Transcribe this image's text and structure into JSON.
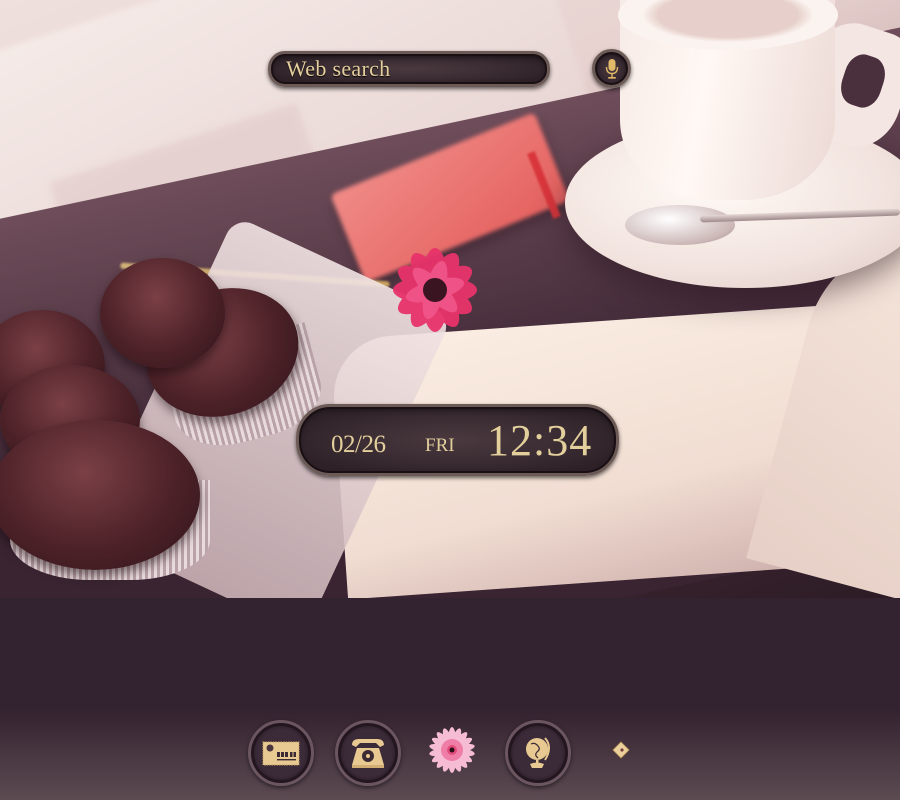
{
  "search": {
    "label": "Web search",
    "mic_icon": "microphone-icon"
  },
  "clock": {
    "date": "02/26",
    "day": "FRI",
    "time": "12:34"
  },
  "dock": {
    "items": [
      {
        "name": "contacts",
        "icon": "id-card-icon"
      },
      {
        "name": "phone",
        "icon": "rotary-phone-icon"
      },
      {
        "name": "theme",
        "icon": "gerbera-flower-icon"
      },
      {
        "name": "browser",
        "icon": "globe-icon"
      },
      {
        "name": "app-drawer",
        "icon": "diamond-icon"
      }
    ]
  },
  "colors": {
    "gold_text": "#e3cf9c",
    "widget_bg": "#2e2228",
    "dock_bg": "#33222f",
    "accent_pink": "#e8336b"
  }
}
